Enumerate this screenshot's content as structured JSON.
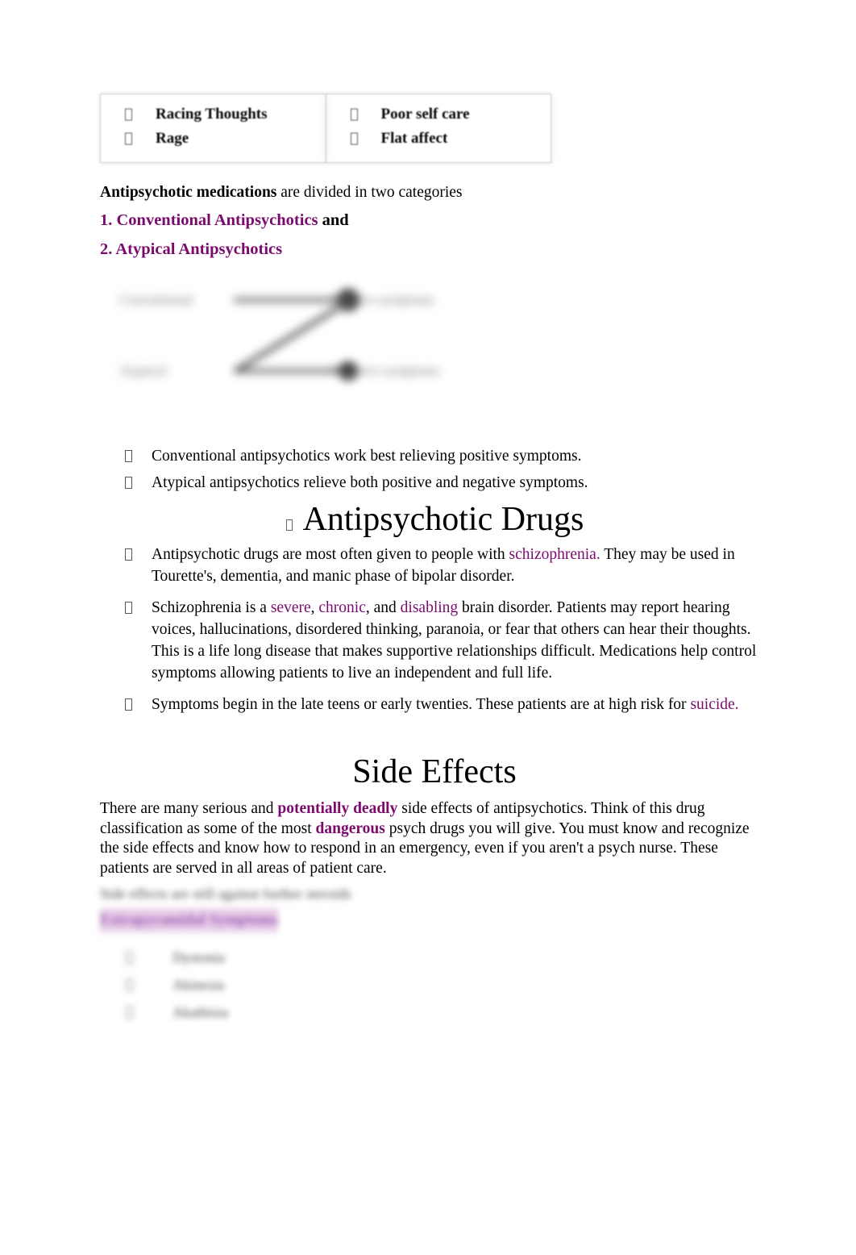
{
  "document": {
    "type": "lecture-notes",
    "colors": {
      "purple_accent": "#7a0a6e",
      "text": "#000000",
      "table_border": "#c8c8c8",
      "redacted_gray": "#4a4a4a",
      "highlight_purple": "#e8cfe8"
    }
  },
  "symptom_table": {
    "columns": [
      {
        "items": [
          "Racing Thoughts",
          "Rage"
        ]
      },
      {
        "items": [
          "Poor self care",
          "Flat affect"
        ]
      }
    ]
  },
  "intro": {
    "lead_bold": "Antipsychotic medications",
    "lead_rest": " are divided in two categories",
    "category_1": "1. Conventional Antipsychotics",
    "category_1_suffix": " and",
    "category_2": "2. Atypical Antipsychotics"
  },
  "diagram": {
    "blurred": true,
    "labels": {
      "top_left": "Conventional",
      "top_right": "Positive symptoms",
      "bottom_left": "Atypical",
      "bottom_right": "Negative symptoms"
    }
  },
  "comparison_bullets": [
    "Conventional antipsychotics work best relieving positive symptoms.",
    "Atypical antipsychotics relieve both positive and negative symptoms."
  ],
  "drugs_section": {
    "heading": "Antipsychotic Drugs",
    "bullets": {
      "b1_part1": "Antipsychotic drugs are most often given to people with ",
      "b1_link": "schizophrenia.",
      "b1_part2": " They may be used in Tourette's, dementia, and manic phase of bipolar disorder.",
      "b2_part1": "Schizophrenia is a ",
      "b2_w1": "severe",
      "b2_sep1": ", ",
      "b2_w2": "chronic",
      "b2_sep2": ", and ",
      "b2_w3": "disabling",
      "b2_part2": " brain disorder. Patients may report hearing voices, hallucinations, disordered thinking, paranoia, or fear that others can hear their thoughts. This is a life long disease that makes supportive relationships difficult. Medications help control symptoms allowing patients to live an independent and full life.",
      "b3_part1": "Symptoms begin in the late teens or early twenties. These patients are at high risk for ",
      "b3_link": "suicide."
    }
  },
  "side_effects_section": {
    "heading": "Side Effects",
    "paragraph": {
      "p1": "There are many serious and ",
      "bold1": "potentially deadly",
      "p2": " side effects of antipsychotics. Think of this drug classification as some of the most ",
      "bold2": "dangerous",
      "p3": " psych drugs you will give. You must know and recognize the side effects and know how to respond in an emergency, even if you aren't a psych nurse. These patients are served in all areas of patient care."
    },
    "redacted": {
      "blurred": true,
      "line_1": "Side effects are still against further steroids",
      "line_2": "Extrapyramidal Symptoms",
      "items": [
        "Dystonia",
        "Akinesia",
        "Akathisia"
      ]
    }
  }
}
